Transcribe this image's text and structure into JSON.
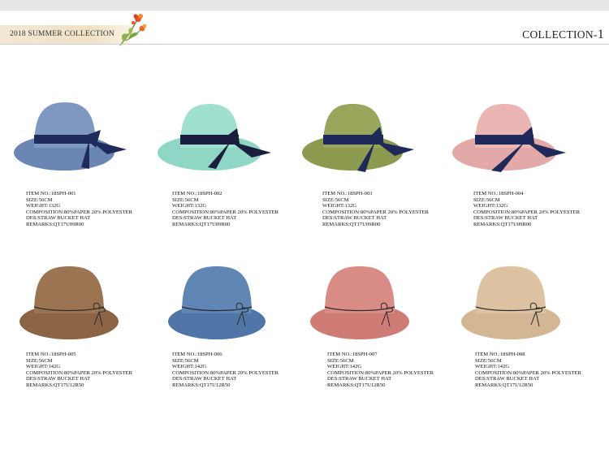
{
  "header": {
    "banner_title": "2018 SUMMER COLLECTION",
    "collection_label": "COLLECTION-",
    "collection_number": "1",
    "banner_color": "#efe2c6"
  },
  "products": [
    {
      "item": "ITEM NO.:18SPH-001",
      "size": "SIZE:56CM",
      "weight": "WEIGHT:132G",
      "composition": "COMPOSITION:80%PAPER 20% POLYESTER",
      "des": "DES:STRAW BUCKET HAT",
      "remarks": "REMARKS:QT17U09R00",
      "hat_color": "#6b86b3",
      "band_color": "#1f2b5c"
    },
    {
      "item": "ITEM NO.:18SPH-002",
      "size": "SIZE:56CM",
      "weight": "WEIGHT:132G",
      "composition": "COMPOSITION:80%PAPER 20% POLYESTER",
      "des": "DES:STRAW BUCKET HAT",
      "remarks": "REMARKS:QT17U09R00",
      "hat_color": "#8fd6c4",
      "band_color": "#1a1d3d"
    },
    {
      "item": "ITEM NO.:18SPH-003",
      "size": "SIZE:56CM",
      "weight": "WEIGHT:132G",
      "composition": "COMPOSITION:80%PAPER 20% POLYESTER",
      "des": "DES:STRAW BUCKET HAT",
      "remarks": "REMARKS:QT17U09R00",
      "hat_color": "#8b9a4e",
      "band_color": "#1f2a5a"
    },
    {
      "item": "ITEM NO.:18SPH-004",
      "size": "SIZE:56CM",
      "weight": "WEIGHT:132G",
      "composition": "COMPOSITION:80%PAPER 20% POLYESTER",
      "des": "DES:STRAW BUCKET HAT",
      "remarks": "REMARKS:QT17U09R00",
      "hat_color": "#e3a9a8",
      "band_color": "#1f2a5a"
    },
    {
      "item": "ITEM NO.:18SPH-005",
      "size": "SIZE:56CM",
      "weight": "WEIGHT:142G",
      "composition": "COMPOSITION:80%PAPER 20% POLYESTER",
      "des": "DES:STRAW BUCKET HAT",
      "remarks": "REMARKS:QT17U12R50",
      "hat_color": "#9c7452",
      "band_color": "#2b2b2b"
    },
    {
      "item": "ITEM NO.:18SPH-006",
      "size": "SIZE:56CM",
      "weight": "WEIGHT:142G",
      "composition": "COMPOSITION:80%PAPER 20% POLYESTER",
      "des": "DES:STRAW BUCKET HAT",
      "remarks": "REMARKS:QT17U12R50",
      "hat_color": "#5f86b4",
      "band_color": "#2b2b2b"
    },
    {
      "item": "ITEM NO.:18SPH-007",
      "size": "SIZE:56CM",
      "weight": "WEIGHT:142G",
      "composition": "COMPOSITION:80%PAPER 20% POLYESTER",
      "des": "DES:STRAW BUCKET HAT",
      "remarks": "REMARKS:QT17U12R50",
      "hat_color": "#d98b86",
      "band_color": "#2b2b2b"
    },
    {
      "item": "ITEM NO.:18SPH-008",
      "size": "SIZE:56CM",
      "weight": "WEIGHT:142G",
      "composition": "COMPOSITION:80%PAPER 20% POLYESTER",
      "des": "DES:STRAW BUCKET HAT",
      "remarks": "REMARKS:QT17U12R50",
      "hat_color": "#ddc2a2",
      "band_color": "#2b2b2b"
    }
  ]
}
